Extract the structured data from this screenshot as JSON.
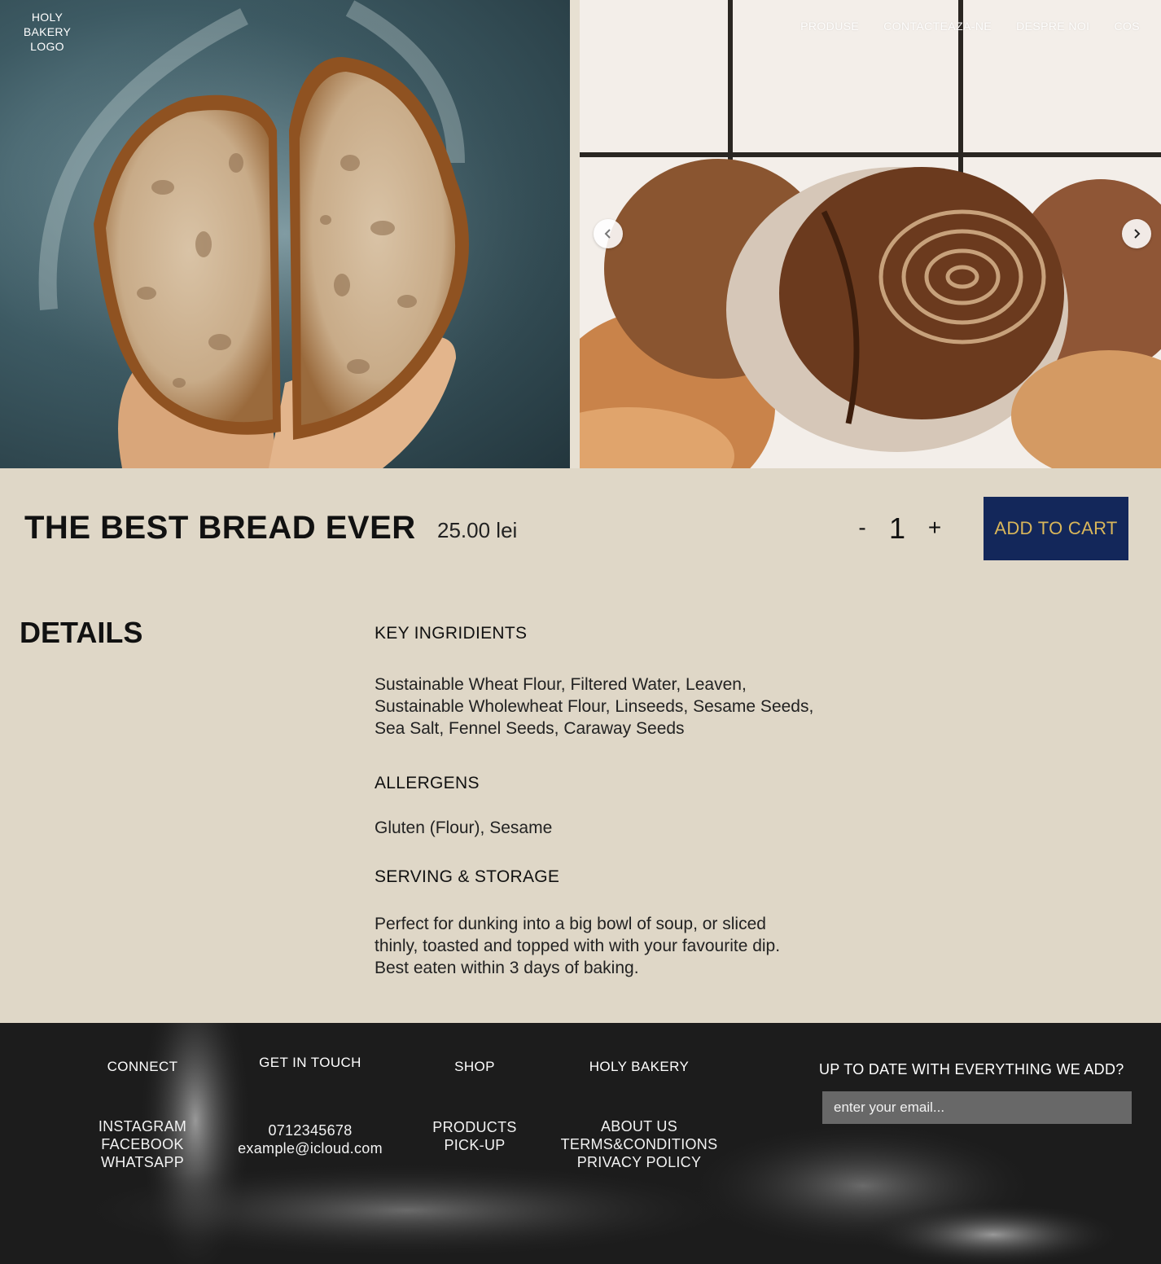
{
  "header": {
    "logo_lines": [
      "HOLY",
      "BAKERY",
      "LOGO"
    ],
    "nav": [
      "PRODUSE",
      "CONTACTEAZA-NE",
      "DESPRE NOI",
      "COS"
    ]
  },
  "carousel": {
    "prev_icon": "chevron-left-icon",
    "next_icon": "chevron-right-icon"
  },
  "product": {
    "title": "THE BEST BREAD EVER",
    "price": "25.00 lei",
    "qty_minus": "-",
    "quantity": "1",
    "qty_plus": "+",
    "add_to_cart": "ADD TO CART",
    "accent_colors": {
      "button_bg": "#13275a",
      "button_text": "#d9b65a"
    }
  },
  "details": {
    "heading": "DETAILS",
    "ingredients_label": "KEY INGRIDIENTS",
    "ingredients_lines": [
      "Sustainable Wheat Flour, Filtered Water, Leaven,",
      "Sustainable Wholewheat Flour, Linseeds, Sesame Seeds,",
      "Sea Salt, Fennel Seeds, Caraway Seeds"
    ],
    "allergens_label": "ALLERGENS",
    "allergens_text": "Gluten (Flour), Sesame",
    "storage_label": "SERVING & STORAGE",
    "storage_lines": [
      "Perfect for dunking into a big bowl of soup, or sliced",
      "thinly, toasted and topped with with your favourite dip.",
      "Best eaten within 3 days of baking."
    ]
  },
  "footer": {
    "connect": {
      "heading": "CONNECT",
      "links": [
        "INSTAGRAM",
        "FACEBOOK",
        "WHATSAPP"
      ]
    },
    "get_in_touch": {
      "heading": "GET IN TOUCH",
      "lines": [
        "0712345678",
        "example@icloud.com"
      ]
    },
    "shop": {
      "heading": "SHOP",
      "links": [
        "PRODUCTS",
        "PICK-UP"
      ]
    },
    "holy_bakery": {
      "heading": "HOLY BAKERY",
      "links": [
        "ABOUT US",
        "TERMS&CONDITIONS",
        "PRIVACY POLICY"
      ]
    },
    "newsletter": {
      "heading": "UP TO DATE WITH EVERYTHING WE ADD?",
      "placeholder": "enter your email..."
    }
  }
}
